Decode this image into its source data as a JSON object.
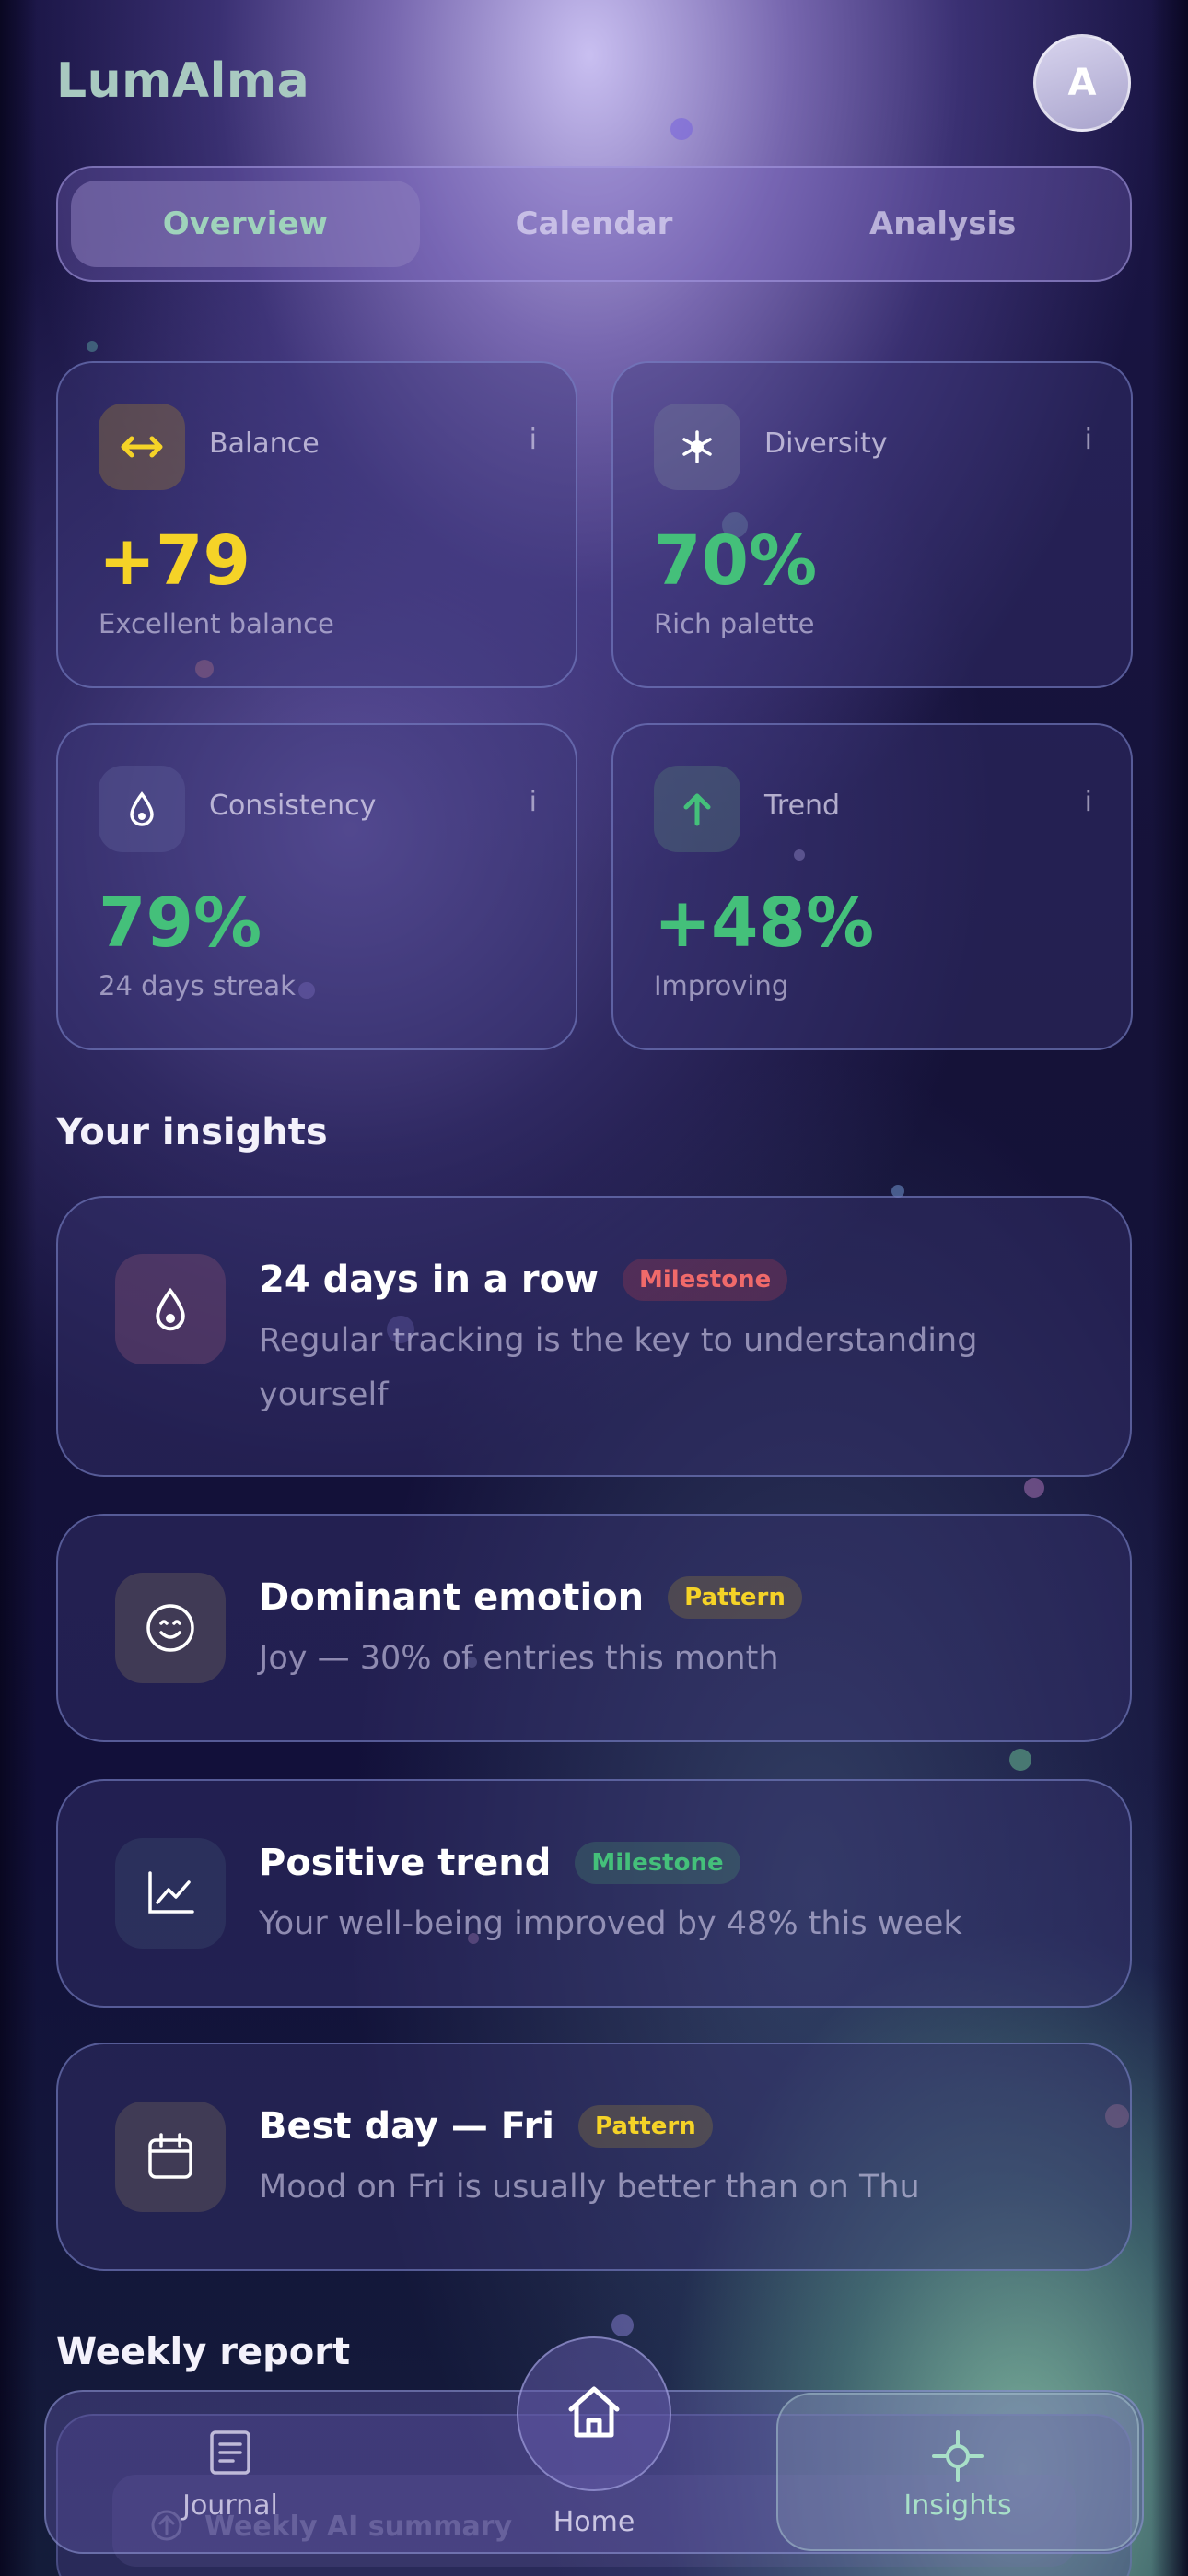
{
  "app": {
    "title": "LumAlma",
    "avatar_initial": "A"
  },
  "tabs": [
    {
      "label": "Overview",
      "active": true
    },
    {
      "label": "Calendar",
      "active": false
    },
    {
      "label": "Analysis",
      "active": false
    }
  ],
  "stats": [
    {
      "label": "Balance",
      "info": "i",
      "value": "+79",
      "sub": "Excellent balance",
      "icon": "arrows-horizontal-icon",
      "color": "#f5d327"
    },
    {
      "label": "Diversity",
      "info": "i",
      "value": "70%",
      "sub": "Rich palette",
      "icon": "sparkle-icon",
      "color": "#44c07a"
    },
    {
      "label": "Consistency",
      "info": "i",
      "value": "79%",
      "sub": "24 days streak",
      "icon": "drop-icon",
      "color": "#44c07a"
    },
    {
      "label": "Trend",
      "info": "i",
      "value": "+48%",
      "sub": "Improving",
      "icon": "arrow-up-icon",
      "color": "#44c07a"
    }
  ],
  "insights_title": "Your insights",
  "insights": [
    {
      "title": "24 days in a row",
      "badge": "Milestone",
      "badge_color": "#f06a6a",
      "desc": "Regular tracking is the key to understanding yourself",
      "icon": "drop-icon"
    },
    {
      "title": "Dominant emotion",
      "badge": "Pattern",
      "badge_color": "#f5d327",
      "desc": "Joy — 30% of entries this month",
      "icon": "smile-icon"
    },
    {
      "title": "Positive trend",
      "badge": "Milestone",
      "badge_color": "#44c07a",
      "desc": "Your well-being improved by 48% this week",
      "icon": "trend-chart-icon"
    },
    {
      "title": "Best day — Fri",
      "badge": "Pattern",
      "badge_color": "#f5d327",
      "desc": "Mood on Fri is usually better than on Thu",
      "icon": "calendar-icon"
    }
  ],
  "weekly": {
    "title": "Weekly report",
    "summary_label": "Weekly AI summary"
  },
  "nav": [
    {
      "label": "Journal",
      "icon": "journal-icon",
      "active": false
    },
    {
      "label": "Home",
      "icon": "home-icon",
      "active": false
    },
    {
      "label": "Insights",
      "icon": "crosshair-icon",
      "active": true
    }
  ]
}
